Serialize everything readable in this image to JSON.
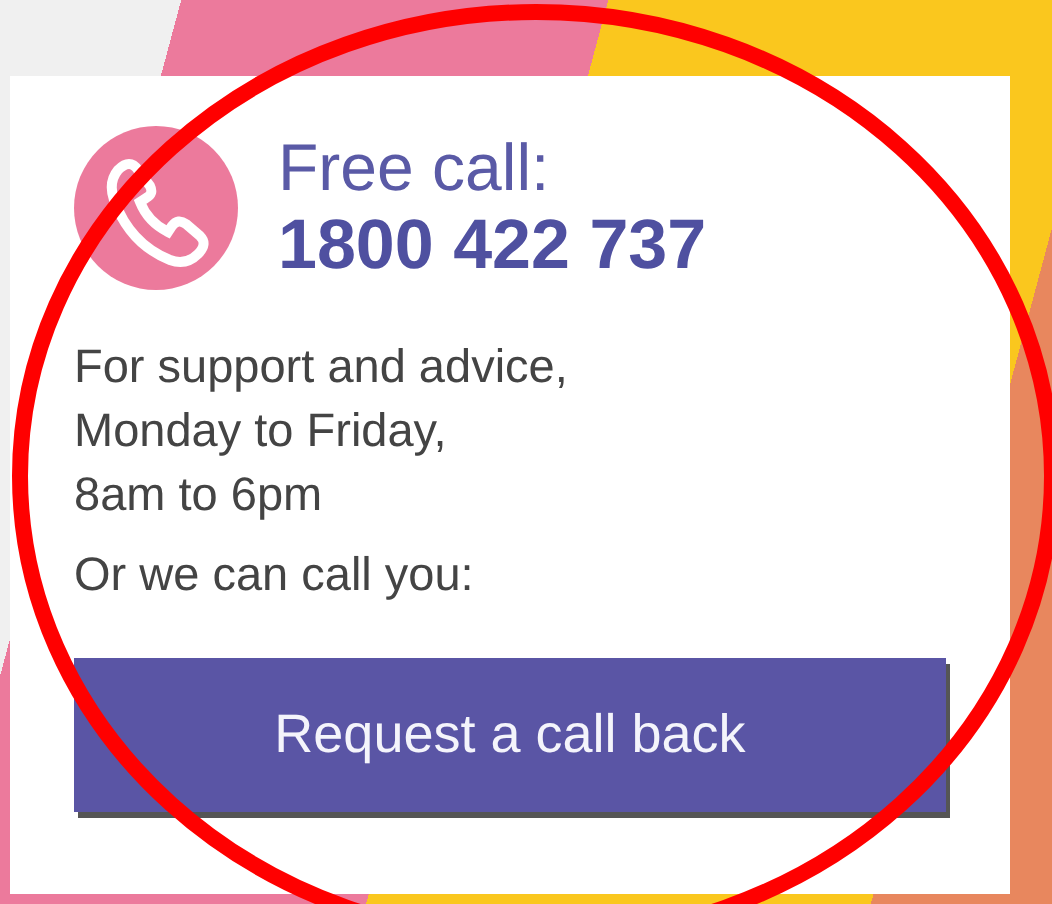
{
  "card": {
    "heading": "Free call:",
    "phone": "1800 422 737",
    "hours": [
      "For support and advice,",
      "Monday to Friday,",
      "8am to 6pm"
    ],
    "prompt": "Or we can call you:",
    "button": "Request a call back"
  }
}
